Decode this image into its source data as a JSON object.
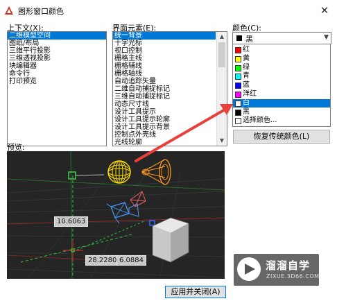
{
  "window": {
    "title": "图形窗口颜色",
    "close_label": "✕"
  },
  "context": {
    "label": "上下文(X):",
    "items": [
      "二维模型空间",
      "图纸/布局",
      "三维平行投影",
      "三维透视投影",
      "块编辑器",
      "命令行",
      "打印预览"
    ],
    "selected_index": 0
  },
  "interface": {
    "label": "界面元素(E):",
    "items": [
      "统一背景",
      "十字光标",
      "视口控制",
      "栅格主线",
      "栅格辅线",
      "栅格轴线",
      "自动追踪矢量",
      "二维自动捕捉标记",
      "三维自动捕捉标记",
      "动态尺寸线",
      "设计工具提示",
      "设计工具提示轮廓",
      "设计工具提示背景",
      "控制点外壳线",
      "光线轮廓"
    ],
    "selected_index": 0
  },
  "color": {
    "label": "颜色(C):",
    "selected_value": "黑",
    "selected_swatch": "#000000",
    "options": [
      {
        "label": "红",
        "swatch": "#ff0000"
      },
      {
        "label": "黄",
        "swatch": "#ffff00"
      },
      {
        "label": "绿",
        "swatch": "#00ff00"
      },
      {
        "label": "青",
        "swatch": "#00ffff"
      },
      {
        "label": "蓝",
        "swatch": "#0000ff"
      },
      {
        "label": "洋红",
        "swatch": "#ff00ff"
      },
      {
        "label": "白",
        "swatch": "#ffffff"
      },
      {
        "label": "黑",
        "swatch": "#000000"
      },
      {
        "label": "选择颜色...",
        "swatch": "#ffffff"
      }
    ],
    "highlighted_index": 6
  },
  "buttons": {
    "restore_label": "恢复传统颜色(L)",
    "apply_label": "应用并关闭(A)"
  },
  "preview": {
    "label": "预览:",
    "dim_1": "10.6063",
    "dim_2": "28.2280",
    "dim_3": "6.0884"
  },
  "watermark": {
    "cn": "溜溜自学",
    "en": "ZIXUE.3D66.COM"
  },
  "colors": {
    "accent": "#0078d7",
    "preview_bg": "#252525",
    "annotation_arrow": "#e8413b"
  },
  "icons": {
    "app": "autocad-logo-icon",
    "close": "close-icon"
  }
}
